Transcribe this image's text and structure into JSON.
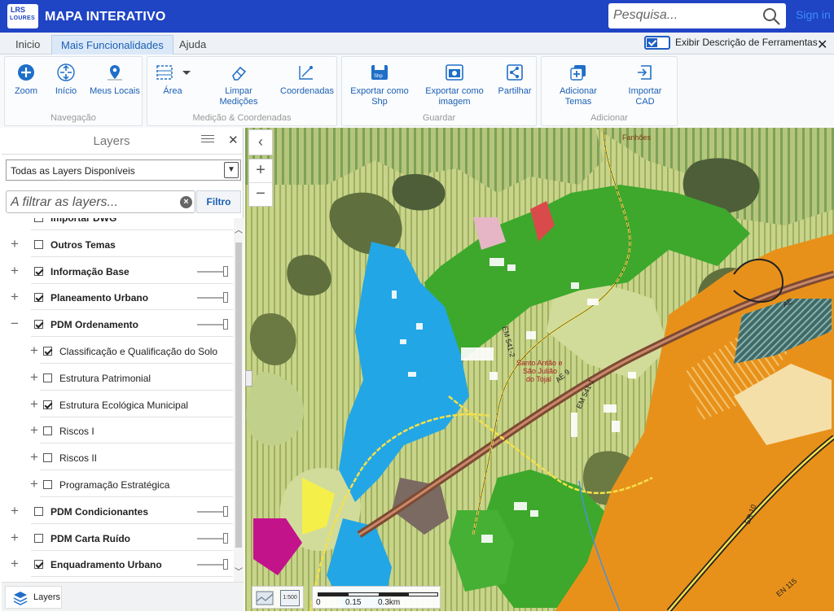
{
  "header": {
    "logo_line1": "LRS",
    "logo_line2": "LOURES",
    "title": "MAPA INTERATIVO",
    "search_placeholder": "Pesquisa...",
    "signin": "Sign in",
    "colors": {
      "brand": "#1f44c4",
      "link": "#3a8cff"
    }
  },
  "menu": {
    "tabs": [
      {
        "label": "Inicio",
        "active": false
      },
      {
        "label": "Mais Funcionalidades",
        "active": true
      },
      {
        "label": "Ajuda",
        "active": false
      }
    ],
    "desc_toggle": {
      "label": "Exibir Descrição de Ferramentas",
      "checked": true
    },
    "close": "✕"
  },
  "ribbon": {
    "groups": [
      {
        "label": "Navegação",
        "buttons": [
          {
            "label": "Zoom",
            "icon": "zoom-plus-icon"
          },
          {
            "label": "Início",
            "icon": "home-extent-icon"
          },
          {
            "label": "Meus Locais",
            "icon": "map-pin-icon"
          }
        ]
      },
      {
        "label": "Medição & Coordenadas",
        "buttons": [
          {
            "label": "Área",
            "icon": "area-measure-icon"
          },
          {
            "label": "Limpar Medições",
            "icon": "eraser-icon"
          },
          {
            "label": "Coordenadas",
            "icon": "coordinates-icon"
          }
        ]
      },
      {
        "label": "Guardar",
        "buttons": [
          {
            "label": "Exportar como Shp",
            "line1": "Exportar como",
            "line2": "Shp",
            "icon": "export-shp-icon"
          },
          {
            "label": "Exportar como imagem",
            "line1": "Exportar como",
            "line2": "imagem",
            "icon": "export-image-icon"
          },
          {
            "label": "Partilhar",
            "icon": "share-icon"
          }
        ]
      },
      {
        "label": "Adicionar",
        "buttons": [
          {
            "label": "Adicionar Temas",
            "icon": "add-layers-icon"
          },
          {
            "label": "Importar CAD",
            "icon": "import-cad-icon"
          }
        ]
      }
    ]
  },
  "layers_panel": {
    "title": "Layers",
    "select_value": "Todas as Layers Disponíveis",
    "filter_placeholder": "A filtrar as layers...",
    "filter_button": "Filtro",
    "footer_tab": "Layers",
    "items": [
      {
        "label": "Importar DWG",
        "level": 0,
        "checked": false,
        "expandable": false,
        "slider": false,
        "slider_value": null
      },
      {
        "label": "Outros Temas",
        "level": 0,
        "checked": false,
        "expandable": true,
        "expanded": false,
        "slider": false,
        "slider_value": null
      },
      {
        "label": "Informação Base",
        "level": 0,
        "checked": true,
        "expandable": true,
        "expanded": false,
        "slider": true,
        "slider_value": 1.0
      },
      {
        "label": "Planeamento Urbano",
        "level": 0,
        "checked": true,
        "expandable": true,
        "expanded": false,
        "slider": true,
        "slider_value": 1.0
      },
      {
        "label": "PDM Ordenamento",
        "level": 0,
        "checked": true,
        "expandable": true,
        "expanded": true,
        "slider": true,
        "slider_value": 1.0
      },
      {
        "label": "Classificação e Qualificação do Solo",
        "level": 1,
        "checked": true,
        "expandable": true,
        "expanded": false,
        "slider": false,
        "slider_value": null
      },
      {
        "label": "Estrutura Patrimonial",
        "level": 1,
        "checked": false,
        "expandable": true,
        "expanded": false,
        "slider": false,
        "slider_value": null
      },
      {
        "label": "Estrutura Ecológica Municipal",
        "level": 1,
        "checked": true,
        "expandable": true,
        "expanded": false,
        "slider": false,
        "slider_value": null
      },
      {
        "label": "Riscos I",
        "level": 1,
        "checked": false,
        "expandable": true,
        "expanded": false,
        "slider": false,
        "slider_value": null
      },
      {
        "label": "Riscos II",
        "level": 1,
        "checked": false,
        "expandable": true,
        "expanded": false,
        "slider": false,
        "slider_value": null
      },
      {
        "label": "Programação Estratégica",
        "level": 1,
        "checked": false,
        "expandable": true,
        "expanded": false,
        "slider": false,
        "slider_value": null
      },
      {
        "label": "PDM Condicionantes",
        "level": 0,
        "checked": false,
        "expandable": true,
        "expanded": false,
        "slider": true,
        "slider_value": 1.0
      },
      {
        "label": "PDM Carta Ruído",
        "level": 0,
        "checked": false,
        "expandable": true,
        "expanded": false,
        "slider": true,
        "slider_value": 1.0
      },
      {
        "label": "Enquadramento Urbano",
        "level": 0,
        "checked": true,
        "expandable": true,
        "expanded": false,
        "slider": true,
        "slider_value": 1.0
      }
    ]
  },
  "map": {
    "scale": {
      "ticks": [
        "0",
        "0.15",
        "0.3km"
      ]
    },
    "labels": {
      "fanhoes": "Fanhões",
      "santo_antao": "Santo Antão e",
      "sao_juliao": "São Julião",
      "do_tojal": "do Tojal",
      "em_5412": "EM 541-2",
      "em_5411": "EM 541-1",
      "ae9": "AE 9",
      "ae": "AE",
      "er10": "ER 10",
      "en115": "EN 115"
    },
    "scale_text": "1:500",
    "colors": {
      "urban_green": "#3da82c",
      "urban_blue": "#22a6e6",
      "orange": "#e8911a",
      "olive": "#b9c46c"
    }
  }
}
